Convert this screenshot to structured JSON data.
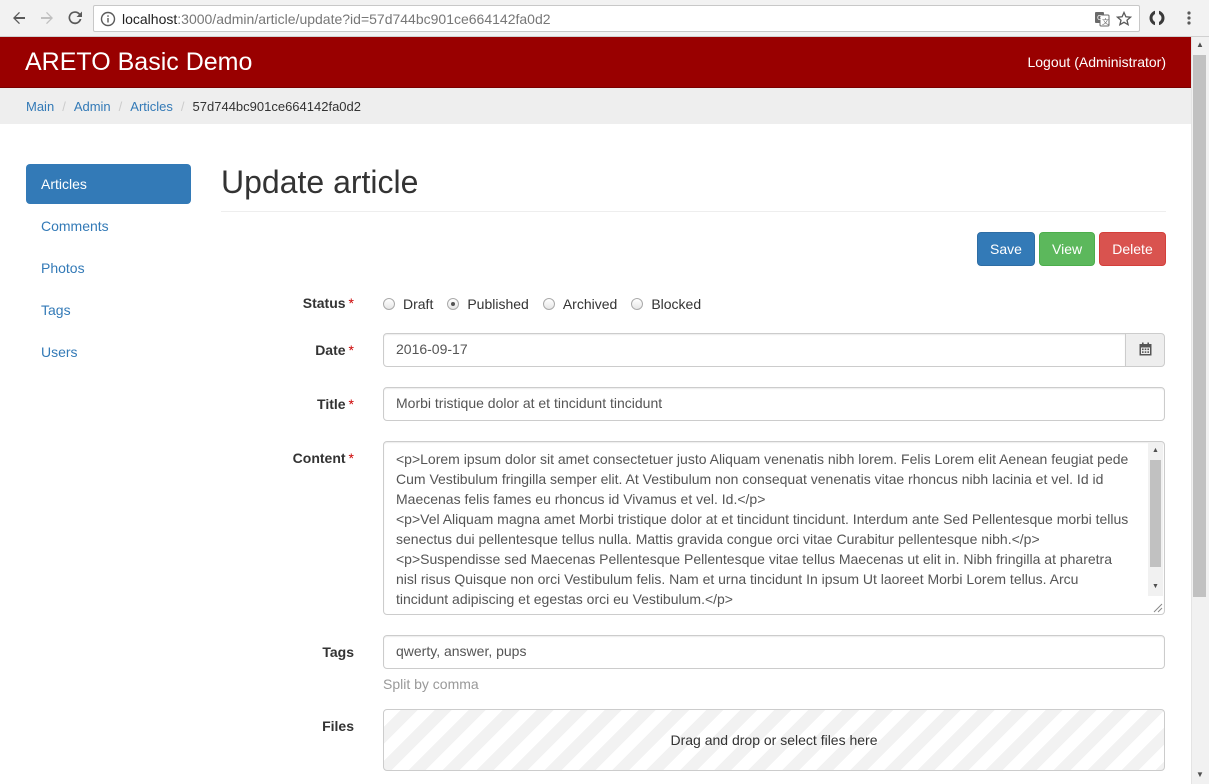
{
  "browser": {
    "url_host": "localhost",
    "url_rest": ":3000/admin/article/update?id=57d744bc901ce664142fa0d2",
    "icons": [
      "back-arrow-icon",
      "forward-arrow-icon",
      "reload-icon",
      "info-icon",
      "translate-icon",
      "star-icon",
      "extension-icon",
      "menu-dots-icon"
    ]
  },
  "navbar": {
    "brand": "ARETO Basic Demo",
    "logout": "Logout (Administrator)",
    "color": "#990000"
  },
  "breadcrumb": {
    "items": [
      "Main",
      "Admin",
      "Articles"
    ],
    "active": "57d744bc901ce664142fa0d2"
  },
  "sidebar": {
    "items": [
      {
        "label": "Articles",
        "active": true
      },
      {
        "label": "Comments",
        "active": false
      },
      {
        "label": "Photos",
        "active": false
      },
      {
        "label": "Tags",
        "active": false
      },
      {
        "label": "Users",
        "active": false
      }
    ]
  },
  "main": {
    "title": "Update article",
    "buttons": {
      "save": "Save",
      "view": "View",
      "delete": "Delete"
    },
    "form": {
      "status": {
        "label": "Status",
        "options": [
          "Draft",
          "Published",
          "Archived",
          "Blocked"
        ],
        "selected": "Published"
      },
      "date": {
        "label": "Date",
        "value": "2016-09-17"
      },
      "title": {
        "label": "Title",
        "value": "Morbi tristique dolor at et tincidunt tincidunt"
      },
      "content": {
        "label": "Content",
        "paragraphs": [
          "<p>Lorem ipsum dolor sit amet consectetuer justo Aliquam venenatis nibh lorem. Felis Lorem elit Aenean feugiat pede Cum Vestibulum fringilla semper elit. At Vestibulum non consequat venenatis vitae rhoncus nibh lacinia et vel. Id id Maecenas felis fames eu rhoncus id Vivamus et vel. Id.</p>",
          "<p>Vel Aliquam magna amet Morbi tristique dolor at et tincidunt tincidunt. Interdum ante Sed Pellentesque morbi tellus senectus dui pellentesque tellus nulla. Mattis gravida congue orci vitae Curabitur pellentesque nibh.</p>",
          "<p>Suspendisse sed Maecenas Pellentesque Pellentesque vitae tellus Maecenas ut elit in. Nibh fringilla at pharetra nisl risus Quisque non orci Vestibulum felis. Nam et urna tincidunt In ipsum Ut laoreet Morbi Lorem tellus. Arcu tincidunt adipiscing et egestas orci eu Vestibulum.</p>"
        ]
      },
      "tags": {
        "label": "Tags",
        "value": "qwerty, answer, pups",
        "help": "Split by comma"
      },
      "files": {
        "label": "Files",
        "dropzone": "Drag and drop or select files here"
      }
    }
  }
}
